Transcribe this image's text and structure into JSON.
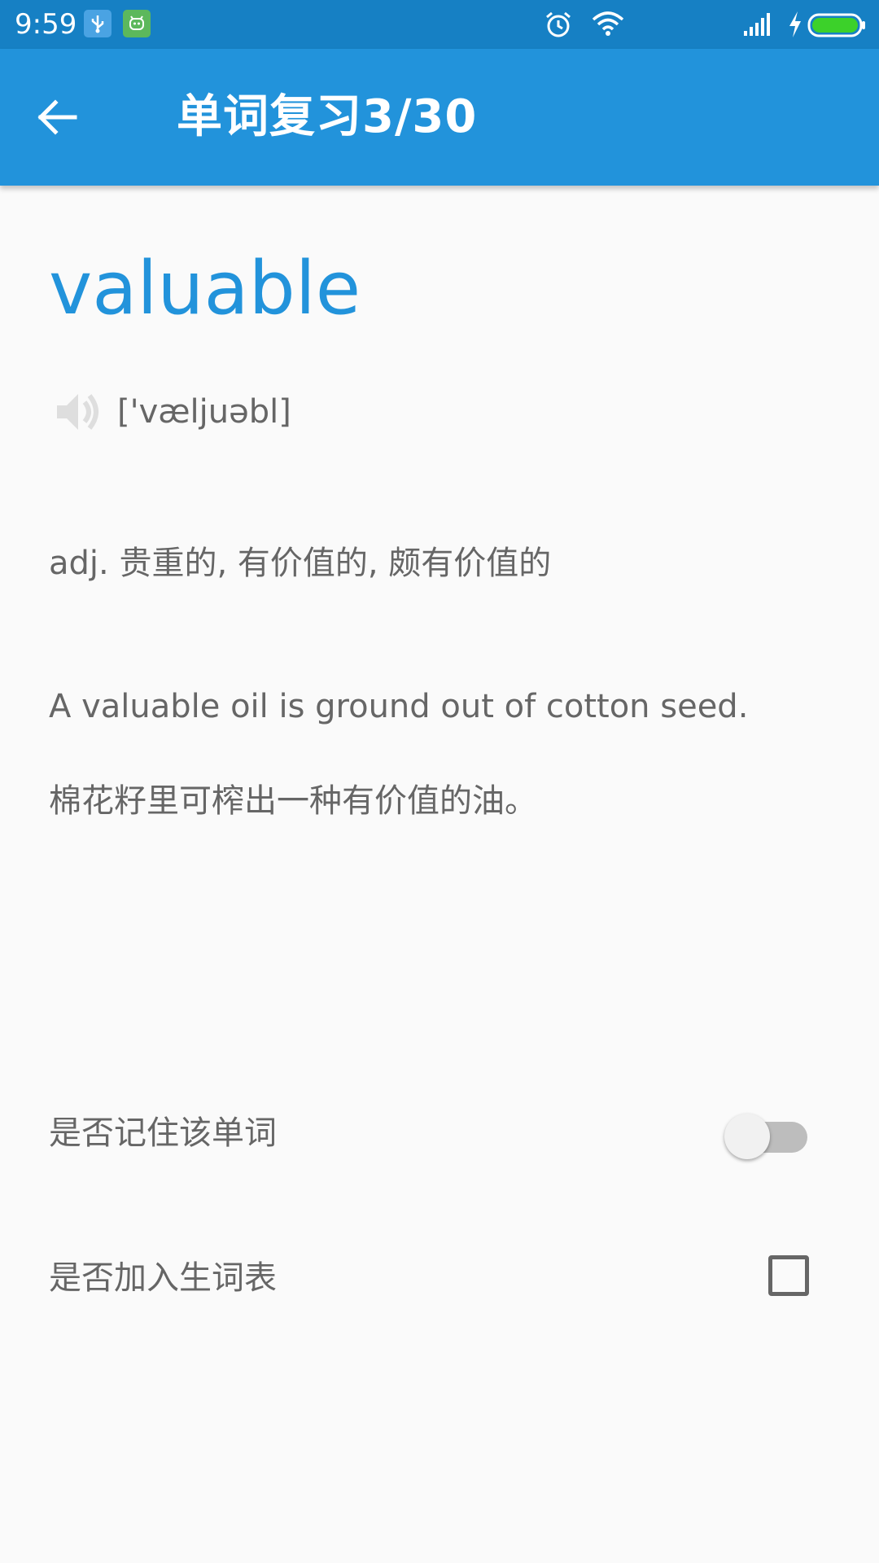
{
  "status_bar": {
    "time": "9:59",
    "icons": [
      "usb-icon",
      "app-notification-icon",
      "alarm-icon",
      "wifi-icon",
      "signal-icon",
      "charging-icon",
      "battery-icon"
    ],
    "background": "#1680c4"
  },
  "app_bar": {
    "title": "单词复习3/30",
    "back_icon": "arrow-back-icon",
    "background": "#2293db"
  },
  "word": {
    "text": "valuable",
    "color": "#2293db",
    "phonetic": "['væljuəbl]",
    "speaker_icon": "speaker-icon"
  },
  "definition": "adj.  贵重的, 有价值的, 颇有价值的",
  "example": {
    "english": "A valuable oil is ground out of cotton seed.",
    "chinese": "棉花籽里可榨出一种有价值的油。"
  },
  "remember": {
    "label": "是否记住该单词",
    "checked": false
  },
  "vocab_list": {
    "label": "是否加入生词表",
    "checked": false
  }
}
